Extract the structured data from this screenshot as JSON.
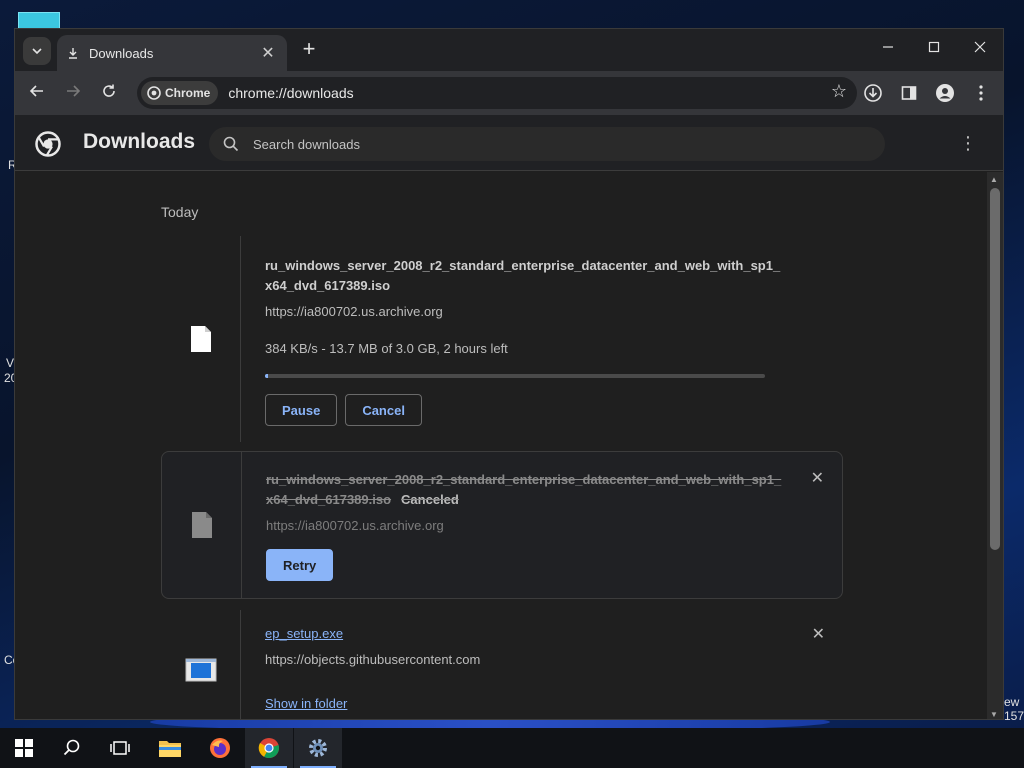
{
  "desktop": {
    "fragments": [
      "R",
      "Vi",
      "20",
      "Co",
      "ew",
      "157"
    ]
  },
  "browser": {
    "tab": {
      "title": "Downloads"
    },
    "omnibox": {
      "chip_label": "Chrome",
      "url": "chrome://downloads"
    }
  },
  "page": {
    "title": "Downloads",
    "search_placeholder": "Search downloads",
    "date_group": "Today",
    "items": [
      {
        "filename": "ru_windows_server_2008_r2_standard_enterprise_datacenter_and_web_with_sp1_x64_dvd_617389.iso",
        "source": "https://ia800702.us.archive.org",
        "progress_text": "384 KB/s - 13.7 MB of 3.0 GB, 2 hours left",
        "progress_fraction": 0.005,
        "pause_label": "Pause",
        "cancel_label": "Cancel"
      },
      {
        "filename": "ru_windows_server_2008_r2_standard_enterprise_datacenter_and_web_with_sp1_x64_dvd_617389.iso",
        "status": "Canceled",
        "source": "https://ia800702.us.archive.org",
        "retry_label": "Retry"
      },
      {
        "filename": "ep_setup.exe",
        "source": "https://objects.githubusercontent.com",
        "show_in_folder_label": "Show in folder"
      }
    ]
  },
  "colors": {
    "accent": "#8ab4f8",
    "window_bg": "#1f1f1f",
    "toolbar_bg": "#35363a"
  }
}
